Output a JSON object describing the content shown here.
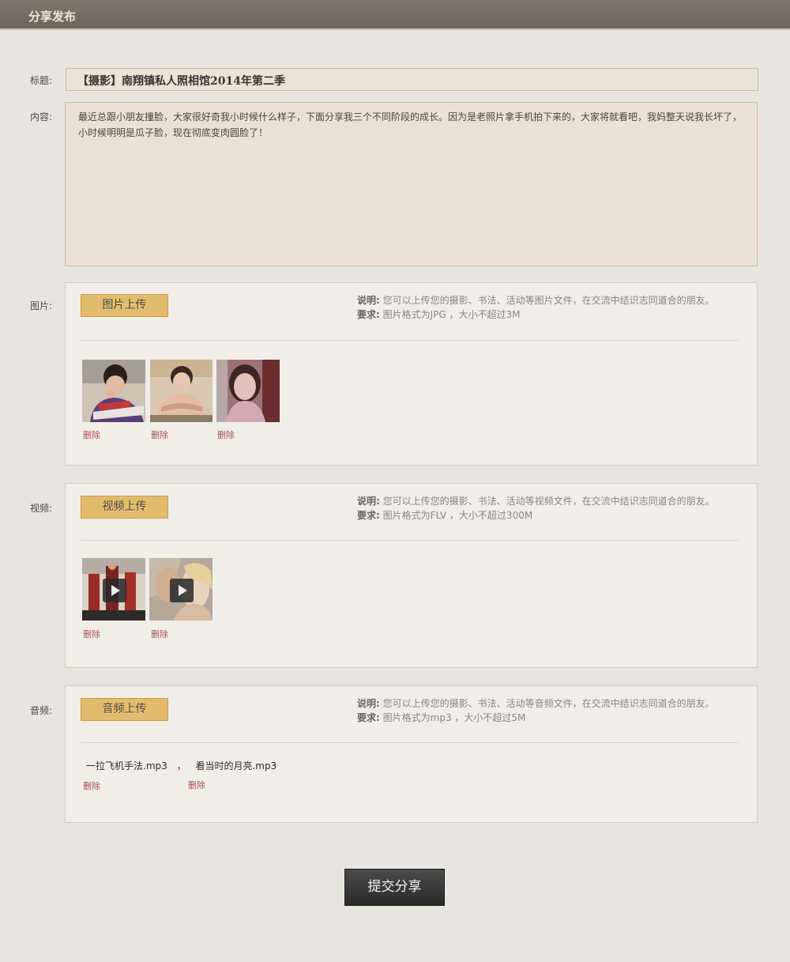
{
  "header": {
    "title": "分享发布"
  },
  "form": {
    "title_label": "标题:",
    "title_value": "【摄影】南翔镇私人照相馆2014年第二季",
    "content_label": "内容:",
    "content_value": "最近总跟小朋友撞脸，大家很好奇我小时候什么样子，下面分享我三个不同阶段的成长。因为是老照片拿手机拍下来的，大家将就看吧，我妈整天说我长坏了，小时候明明是瓜子脸，现在彻底变肉圆脸了！"
  },
  "images": {
    "label": "图片:",
    "upload_label": "图片上传",
    "desc_key": "说明:",
    "desc_text": "您可以上传您的摄影、书法、活动等图片文件，在交流中结识志同道合的朋友。",
    "req_key": "要求:",
    "req_text": "图片格式为JPG ，大小不超过3M",
    "delete_label": "删除"
  },
  "videos": {
    "label": "视频:",
    "upload_label": "视频上传",
    "desc_key": "说明:",
    "desc_text": "您可以上传您的摄影、书法、活动等视频文件，在交流中结识志同道合的朋友。",
    "req_key": "要求:",
    "req_text": "图片格式为FLV ，大小不超过300M",
    "delete_label": "删除"
  },
  "audio": {
    "label": "音频:",
    "upload_label": "音频上传",
    "desc_key": "说明:",
    "desc_text": "您可以上传您的摄影、书法、活动等音频文件，在交流中结识志同道合的朋友。",
    "req_key": "要求:",
    "req_text": "图片格式为mp3 ，大小不超过5M",
    "files": [
      "一拉飞机手法.mp3",
      "看当时的月亮.mp3"
    ],
    "separator": "，",
    "delete_label": "删除"
  },
  "submit_label": "提交分享"
}
